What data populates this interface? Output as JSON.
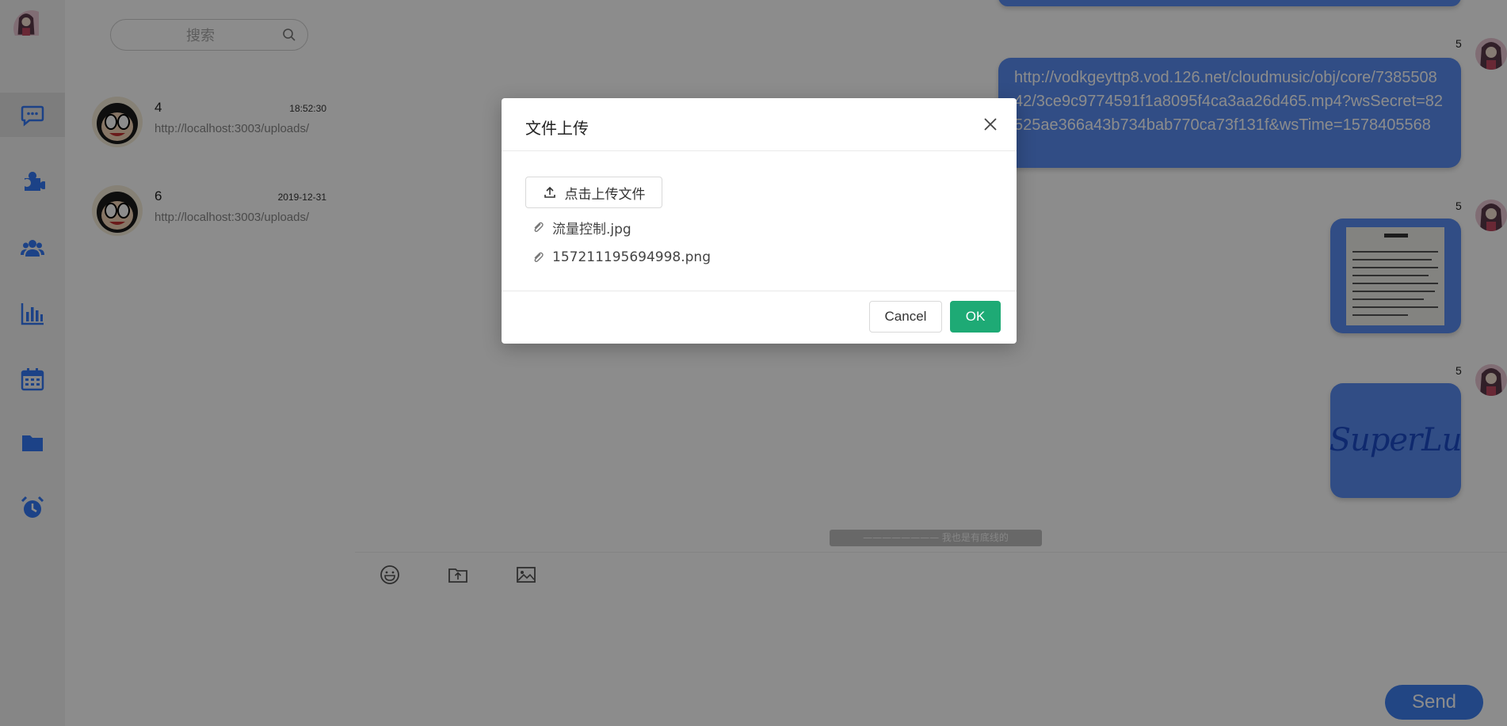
{
  "search": {
    "placeholder": "搜索"
  },
  "sidebar": {
    "items": [
      {
        "icon": "chat-bubble-icon",
        "active": true
      },
      {
        "icon": "puzzle-icon"
      },
      {
        "icon": "users-icon"
      },
      {
        "icon": "bar-chart-icon"
      },
      {
        "icon": "calendar-icon"
      },
      {
        "icon": "folder-icon"
      },
      {
        "icon": "alarm-clock-icon"
      }
    ]
  },
  "conversations": [
    {
      "name": "4",
      "time": "18:52:30",
      "preview": "http://localhost:3003/uploads/"
    },
    {
      "name": "6",
      "time": "2019-12-31",
      "preview": "http://localhost:3003/uploads/"
    }
  ],
  "messages": [
    {
      "sender": "5",
      "text": "http://vodkgeyttp8.vod.126.net/cloudmusic/obj/core/738550842/3ce9c9774591f1a8095f4ca3aa26d465.mp4?wsSecret=82525ae366a43b734bab770ca73f131f&wsTime=1578405568"
    },
    {
      "sender": "5",
      "image": "document-photo"
    },
    {
      "sender": "5",
      "image": "superlu-logo",
      "logo_text": "SuperLu"
    }
  ],
  "footer_tag": "———————— 我也是有底线的 ————————",
  "composer": {
    "send_label": "Send"
  },
  "modal": {
    "title": "文件上传",
    "upload_label": "点击上传文件",
    "files": [
      "流量控制.jpg",
      "157211195694998.png"
    ],
    "cancel_label": "Cancel",
    "ok_label": "OK"
  },
  "colors": {
    "bubble": "#5a8df2",
    "ok_button": "#1eaa75",
    "send_button": "#3f80f0",
    "rail_icon": "#3478f6",
    "mask": "rgba(0,0,0,0.45)"
  }
}
